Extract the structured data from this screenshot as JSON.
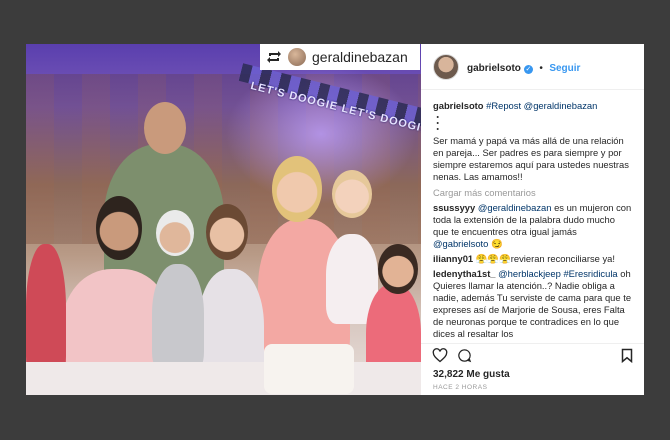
{
  "repost_overlay": {
    "username": "geraldinebazan"
  },
  "photo": {
    "banner_text": "LET'S DOOGIE LET'S DOOGIE"
  },
  "header": {
    "username": "gabrielsoto",
    "separator": "•",
    "follow": "Seguir"
  },
  "caption": {
    "username": "gabrielsoto",
    "repost_tag": "#Repost",
    "mention": "@geraldinebazan",
    "dots": [
      "・",
      "・",
      "・"
    ],
    "text": "Ser mamá y papá va más allá de una relación en pareja... Ser padres es para siempre y por siempre estaremos aquí para ustedes nuestras nenas. Las amamos!!"
  },
  "load_more": "Cargar más comentarios",
  "comments": [
    {
      "username": "ssussyyy",
      "text_parts": [
        {
          "tag": "@geraldinebazan"
        },
        {
          "t": " es un mujeron con toda la extensión de la palabra dudo mucho que te encuentres otra igual jamás "
        },
        {
          "tag": "@gabrielsoto"
        },
        {
          "t": " 😏"
        }
      ]
    },
    {
      "username": "ilianny01",
      "text_parts": [
        {
          "t": "😤😤😤revieran reconciliarse ya!"
        }
      ]
    },
    {
      "username": "ledenytha1st_",
      "text_parts": [
        {
          "tag": "@herblackjeep"
        },
        {
          "t": " "
        },
        {
          "tag": "#Eresridicula"
        },
        {
          "t": " oh Quieres llamar la atención..? Nadie obliga a nadie, además Tu serviste de cama para que te expreses así de Marjorie de Sousa, eres Falta de neuronas porque te contradices en lo que dices al resaltar los"
        }
      ]
    }
  ],
  "likes": "32,822 Me gusta",
  "timestamp": "HACE 2 HORAS",
  "icons": {
    "like": "heart-icon",
    "comment": "comment-icon",
    "save": "bookmark-icon",
    "repost": "repost-icon",
    "verified": "verified-check-icon"
  },
  "colors": {
    "link": "#003569",
    "follow": "#3897f0",
    "text": "#262626",
    "muted": "#999999"
  }
}
